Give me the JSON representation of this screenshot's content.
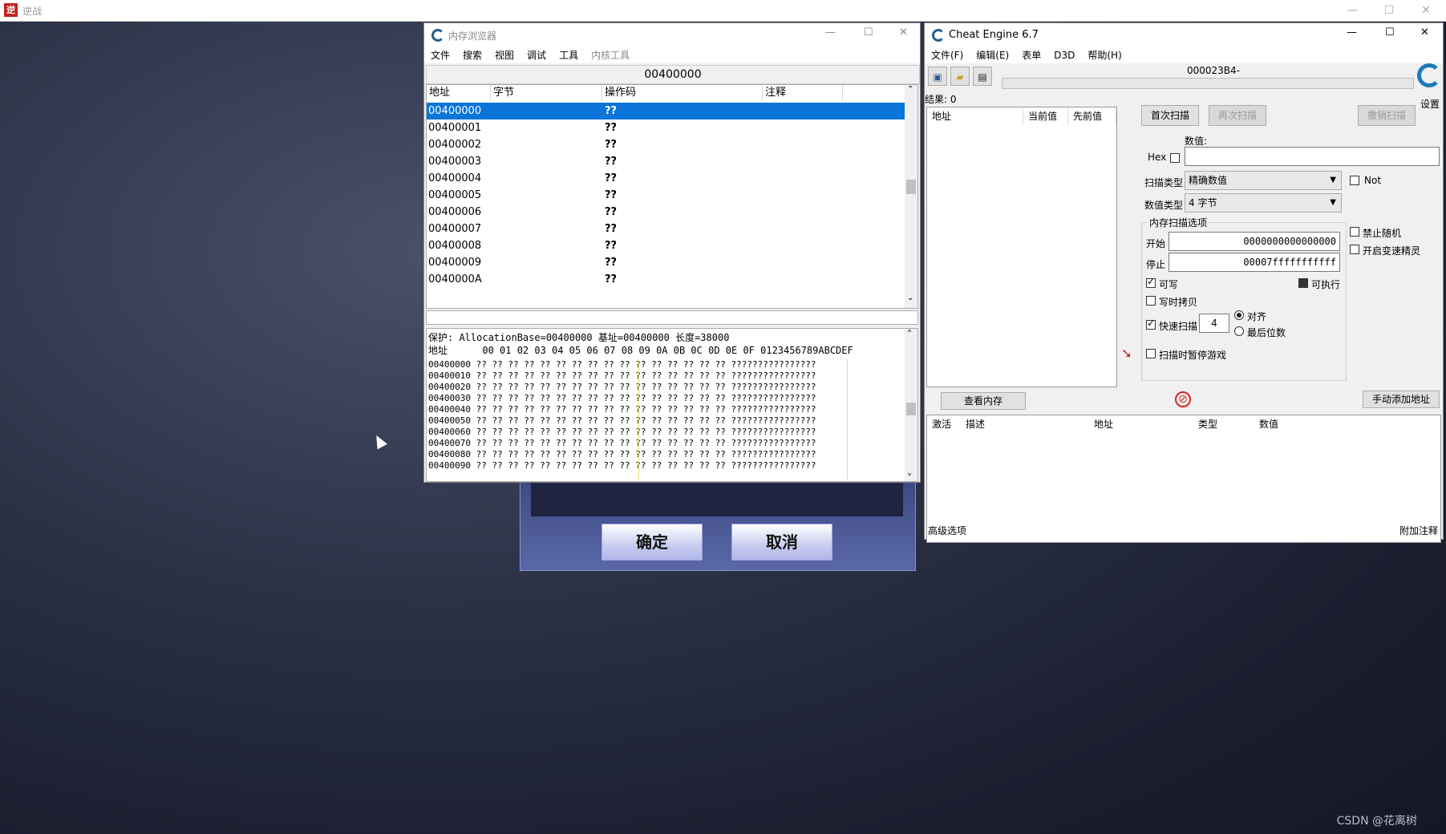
{
  "game": {
    "title": "逆战",
    "icon": "逆",
    "ok": "确定",
    "cancel": "取消",
    "watermark": "CSDN @花离树"
  },
  "memview": {
    "title": "内存浏览器",
    "menu": [
      "文件",
      "搜索",
      "视图",
      "调试",
      "工具",
      "内核工具"
    ],
    "address_bar": "00400000",
    "headers": [
      "地址",
      "字节",
      "操作码",
      "注释"
    ],
    "rows": [
      {
        "addr": "00400000",
        "op": "??"
      },
      {
        "addr": "00400001",
        "op": "??"
      },
      {
        "addr": "00400002",
        "op": "??"
      },
      {
        "addr": "00400003",
        "op": "??"
      },
      {
        "addr": "00400004",
        "op": "??"
      },
      {
        "addr": "00400005",
        "op": "??"
      },
      {
        "addr": "00400006",
        "op": "??"
      },
      {
        "addr": "00400007",
        "op": "??"
      },
      {
        "addr": "00400008",
        "op": "??"
      },
      {
        "addr": "00400009",
        "op": "??"
      },
      {
        "addr": "0040000A",
        "op": "??"
      }
    ],
    "protect_line": "保护: AllocationBase=00400000 基址=00400000 长度=38000",
    "hex_header": "地址      00 01 02 03 04 05 06 07 08 09 0A 0B 0C 0D 0E 0F 0123456789ABCDEF",
    "hex_rows": [
      "00400000 ?? ?? ?? ?? ?? ?? ?? ?? ?? ?? ?? ?? ?? ?? ?? ?? ????????????????",
      "00400010 ?? ?? ?? ?? ?? ?? ?? ?? ?? ?? ?? ?? ?? ?? ?? ?? ????????????????",
      "00400020 ?? ?? ?? ?? ?? ?? ?? ?? ?? ?? ?? ?? ?? ?? ?? ?? ????????????????",
      "00400030 ?? ?? ?? ?? ?? ?? ?? ?? ?? ?? ?? ?? ?? ?? ?? ?? ????????????????",
      "00400040 ?? ?? ?? ?? ?? ?? ?? ?? ?? ?? ?? ?? ?? ?? ?? ?? ????????????????",
      "00400050 ?? ?? ?? ?? ?? ?? ?? ?? ?? ?? ?? ?? ?? ?? ?? ?? ????????????????",
      "00400060 ?? ?? ?? ?? ?? ?? ?? ?? ?? ?? ?? ?? ?? ?? ?? ?? ????????????????",
      "00400070 ?? ?? ?? ?? ?? ?? ?? ?? ?? ?? ?? ?? ?? ?? ?? ?? ????????????????",
      "00400080 ?? ?? ?? ?? ?? ?? ?? ?? ?? ?? ?? ?? ?? ?? ?? ?? ????????????????",
      "00400090 ?? ?? ?? ?? ?? ?? ?? ?? ?? ?? ?? ?? ?? ?? ?? ?? ????????????????"
    ]
  },
  "ce": {
    "title": "Cheat Engine 6.7",
    "menu": [
      "文件(F)",
      "编辑(E)",
      "表单",
      "D3D",
      "帮助(H)"
    ],
    "process": "000023B4-",
    "results": "结果: 0",
    "settings": "设置",
    "list_headers": [
      "地址",
      "当前值",
      "先前值"
    ],
    "first_scan": "首次扫描",
    "next_scan": "再次扫描",
    "undo_scan": "撤销扫描",
    "value_label": "数值:",
    "hex_label": "Hex",
    "scan_type_label": "扫描类型",
    "scan_type": "精确数值",
    "value_type_label": "数值类型",
    "value_type": "4 字节",
    "not_label": "Not",
    "mem_opts": "内存扫描选项",
    "start_label": "开始",
    "start": "0000000000000000",
    "stop_label": "停止",
    "stop": "00007fffffffffff",
    "writable": "可写",
    "executable": "可执行",
    "copy_on_write": "写时拷贝",
    "fast_scan": "快速扫描",
    "fast_val": "4",
    "align": "对齐",
    "last_digits": "最后位数",
    "pause_game": "扫描时暂停游戏",
    "no_random": "禁止随机",
    "speedhack": "开启变速精灵",
    "view_memory": "查看内存",
    "add_address": "手动添加地址",
    "table_headers": [
      "激活",
      "描述",
      "地址",
      "类型",
      "数值"
    ],
    "advanced": "高级选项",
    "table_extras": "附加注释"
  }
}
